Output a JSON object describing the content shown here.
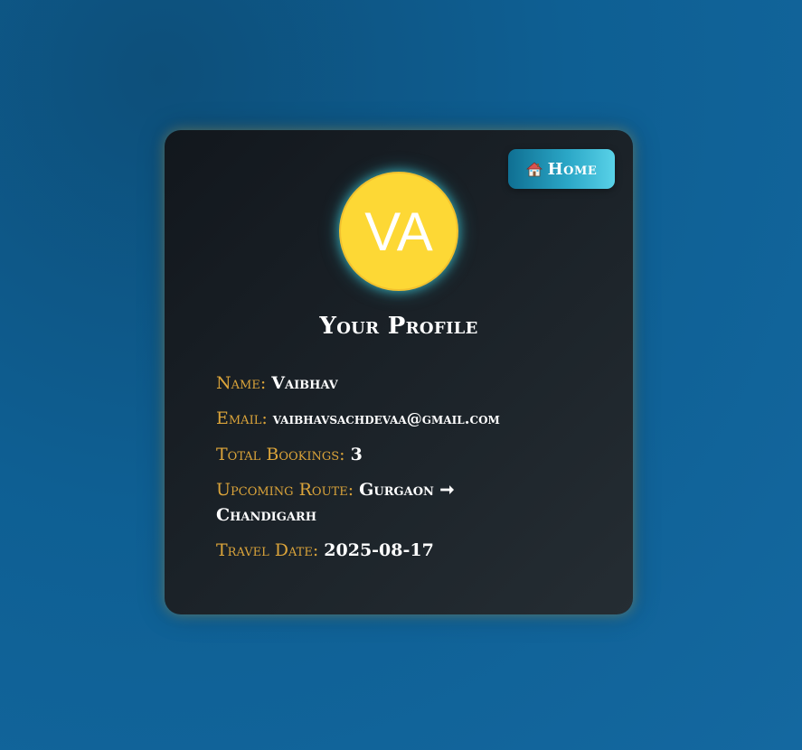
{
  "header": {
    "home_label": "Home",
    "home_icon": "house-icon"
  },
  "avatar": {
    "initials": "VA",
    "background_color": "#fdd835"
  },
  "profile": {
    "title": "Your Profile",
    "fields": {
      "name": {
        "label": "Name:",
        "value": "Vaibhav"
      },
      "email": {
        "label": "Email:",
        "value": "vaibhavsachdevaa@gmail.com"
      },
      "total_bookings": {
        "label": "Total Bookings:",
        "value": "3"
      },
      "upcoming_route": {
        "label": "Upcoming Route:",
        "value": "Gurgaon ➞ Chandigarh"
      },
      "travel_date": {
        "label": "Travel Date:",
        "value": "2025-08-17"
      }
    }
  },
  "colors": {
    "label": "#dba43a",
    "card_bg": "#1b2228",
    "accent_cyan": "#2aa6c6",
    "page_bg": "#0e5f93"
  }
}
